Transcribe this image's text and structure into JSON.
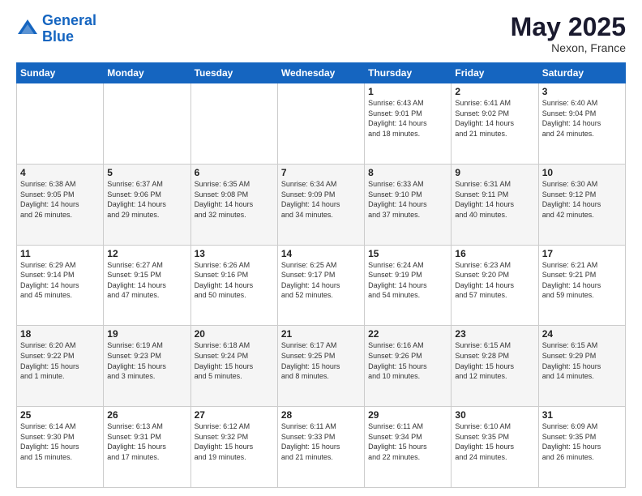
{
  "header": {
    "logo_line1": "General",
    "logo_line2": "Blue",
    "month": "May 2025",
    "location": "Nexon, France"
  },
  "days_of_week": [
    "Sunday",
    "Monday",
    "Tuesday",
    "Wednesday",
    "Thursday",
    "Friday",
    "Saturday"
  ],
  "weeks": [
    [
      {
        "day": "",
        "info": ""
      },
      {
        "day": "",
        "info": ""
      },
      {
        "day": "",
        "info": ""
      },
      {
        "day": "",
        "info": ""
      },
      {
        "day": "1",
        "info": "Sunrise: 6:43 AM\nSunset: 9:01 PM\nDaylight: 14 hours\nand 18 minutes."
      },
      {
        "day": "2",
        "info": "Sunrise: 6:41 AM\nSunset: 9:02 PM\nDaylight: 14 hours\nand 21 minutes."
      },
      {
        "day": "3",
        "info": "Sunrise: 6:40 AM\nSunset: 9:04 PM\nDaylight: 14 hours\nand 24 minutes."
      }
    ],
    [
      {
        "day": "4",
        "info": "Sunrise: 6:38 AM\nSunset: 9:05 PM\nDaylight: 14 hours\nand 26 minutes."
      },
      {
        "day": "5",
        "info": "Sunrise: 6:37 AM\nSunset: 9:06 PM\nDaylight: 14 hours\nand 29 minutes."
      },
      {
        "day": "6",
        "info": "Sunrise: 6:35 AM\nSunset: 9:08 PM\nDaylight: 14 hours\nand 32 minutes."
      },
      {
        "day": "7",
        "info": "Sunrise: 6:34 AM\nSunset: 9:09 PM\nDaylight: 14 hours\nand 34 minutes."
      },
      {
        "day": "8",
        "info": "Sunrise: 6:33 AM\nSunset: 9:10 PM\nDaylight: 14 hours\nand 37 minutes."
      },
      {
        "day": "9",
        "info": "Sunrise: 6:31 AM\nSunset: 9:11 PM\nDaylight: 14 hours\nand 40 minutes."
      },
      {
        "day": "10",
        "info": "Sunrise: 6:30 AM\nSunset: 9:12 PM\nDaylight: 14 hours\nand 42 minutes."
      }
    ],
    [
      {
        "day": "11",
        "info": "Sunrise: 6:29 AM\nSunset: 9:14 PM\nDaylight: 14 hours\nand 45 minutes."
      },
      {
        "day": "12",
        "info": "Sunrise: 6:27 AM\nSunset: 9:15 PM\nDaylight: 14 hours\nand 47 minutes."
      },
      {
        "day": "13",
        "info": "Sunrise: 6:26 AM\nSunset: 9:16 PM\nDaylight: 14 hours\nand 50 minutes."
      },
      {
        "day": "14",
        "info": "Sunrise: 6:25 AM\nSunset: 9:17 PM\nDaylight: 14 hours\nand 52 minutes."
      },
      {
        "day": "15",
        "info": "Sunrise: 6:24 AM\nSunset: 9:19 PM\nDaylight: 14 hours\nand 54 minutes."
      },
      {
        "day": "16",
        "info": "Sunrise: 6:23 AM\nSunset: 9:20 PM\nDaylight: 14 hours\nand 57 minutes."
      },
      {
        "day": "17",
        "info": "Sunrise: 6:21 AM\nSunset: 9:21 PM\nDaylight: 14 hours\nand 59 minutes."
      }
    ],
    [
      {
        "day": "18",
        "info": "Sunrise: 6:20 AM\nSunset: 9:22 PM\nDaylight: 15 hours\nand 1 minute."
      },
      {
        "day": "19",
        "info": "Sunrise: 6:19 AM\nSunset: 9:23 PM\nDaylight: 15 hours\nand 3 minutes."
      },
      {
        "day": "20",
        "info": "Sunrise: 6:18 AM\nSunset: 9:24 PM\nDaylight: 15 hours\nand 5 minutes."
      },
      {
        "day": "21",
        "info": "Sunrise: 6:17 AM\nSunset: 9:25 PM\nDaylight: 15 hours\nand 8 minutes."
      },
      {
        "day": "22",
        "info": "Sunrise: 6:16 AM\nSunset: 9:26 PM\nDaylight: 15 hours\nand 10 minutes."
      },
      {
        "day": "23",
        "info": "Sunrise: 6:15 AM\nSunset: 9:28 PM\nDaylight: 15 hours\nand 12 minutes."
      },
      {
        "day": "24",
        "info": "Sunrise: 6:15 AM\nSunset: 9:29 PM\nDaylight: 15 hours\nand 14 minutes."
      }
    ],
    [
      {
        "day": "25",
        "info": "Sunrise: 6:14 AM\nSunset: 9:30 PM\nDaylight: 15 hours\nand 15 minutes."
      },
      {
        "day": "26",
        "info": "Sunrise: 6:13 AM\nSunset: 9:31 PM\nDaylight: 15 hours\nand 17 minutes."
      },
      {
        "day": "27",
        "info": "Sunrise: 6:12 AM\nSunset: 9:32 PM\nDaylight: 15 hours\nand 19 minutes."
      },
      {
        "day": "28",
        "info": "Sunrise: 6:11 AM\nSunset: 9:33 PM\nDaylight: 15 hours\nand 21 minutes."
      },
      {
        "day": "29",
        "info": "Sunrise: 6:11 AM\nSunset: 9:34 PM\nDaylight: 15 hours\nand 22 minutes."
      },
      {
        "day": "30",
        "info": "Sunrise: 6:10 AM\nSunset: 9:35 PM\nDaylight: 15 hours\nand 24 minutes."
      },
      {
        "day": "31",
        "info": "Sunrise: 6:09 AM\nSunset: 9:35 PM\nDaylight: 15 hours\nand 26 minutes."
      }
    ]
  ]
}
